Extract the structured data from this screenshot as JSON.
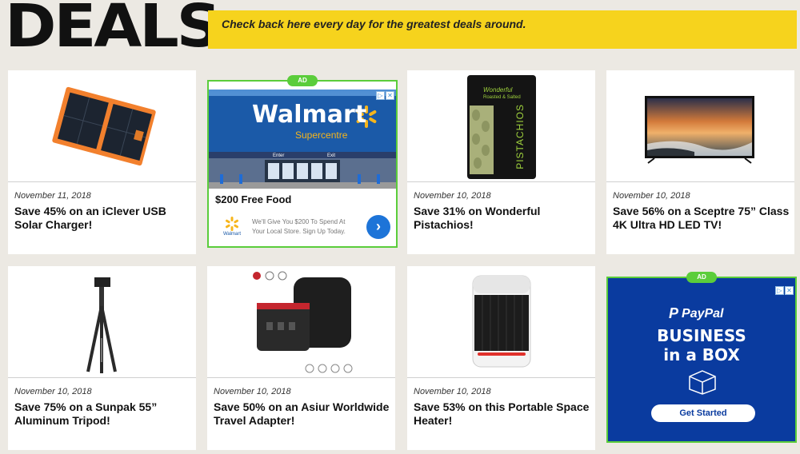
{
  "header": {
    "title": "DEALS",
    "tagline": "Check back here every day for the greatest deals around."
  },
  "ad_badge": "AD",
  "deals": [
    {
      "date": "November 11, 2018",
      "title": "Save 45% on an iClever USB Solar Charger!",
      "image": "solar-charger"
    },
    {
      "date": "November 10, 2018",
      "title": "Save 31% on Wonderful Pistachios!",
      "image": "pistachios-bag"
    },
    {
      "date": "November 10, 2018",
      "title": "Save 56% on a Sceptre 75” Class 4K Ultra HD LED TV!",
      "image": "tv"
    },
    {
      "date": "November 10, 2018",
      "title": "Save 75% on a Sunpak 55” Aluminum Tripod!",
      "image": "tripod"
    },
    {
      "date": "November 10, 2018",
      "title": "Save 50% on an Asiur Worldwide Travel Adapter!",
      "image": "travel-adapter"
    },
    {
      "date": "November 10, 2018",
      "title": "Save 53% on this Portable Space Heater!",
      "image": "space-heater"
    }
  ],
  "walmart_ad": {
    "brand": "Walmart",
    "sub": "Supercentre",
    "headline": "$200 Free Food",
    "body": "We'll Give You $200 To Spend At Your Local Store. Sign Up Today.",
    "logo_label": "Walmart",
    "store_signs": [
      "Enter",
      "Exit"
    ]
  },
  "paypal_ad": {
    "brand": "PayPal",
    "line1": "BUSINESS",
    "line2": "in a BOX",
    "cta": "Get Started"
  },
  "product_text": {
    "pistachio_top": "Wonderful",
    "pistachio_sub": "Roasted & Salted",
    "pistachio_name": "PISTACHIOS"
  },
  "colors": {
    "banner": "#f6d31d",
    "ad_border": "#5bcd3b",
    "walmart_blue": "#1b5aa8",
    "walmart_yellow": "#f7b51b",
    "paypal_blue": "#0a3b9f"
  }
}
